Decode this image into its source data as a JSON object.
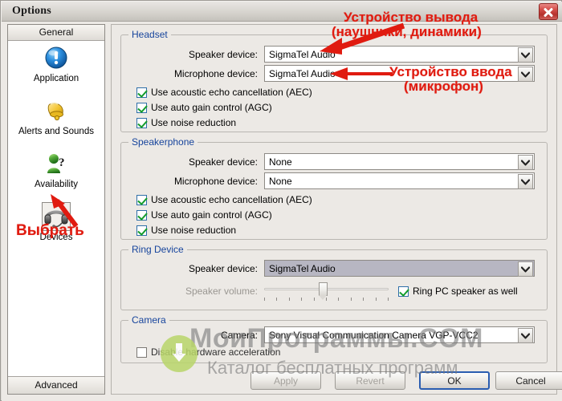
{
  "window": {
    "title": "Options",
    "close_tooltip": "Close"
  },
  "sidebar": {
    "header": "General",
    "footer": "Advanced",
    "items": [
      {
        "label": "Application",
        "icon": "exclamation-circle-icon"
      },
      {
        "label": "Alerts and Sounds",
        "icon": "bell-icon"
      },
      {
        "label": "Availability",
        "icon": "availability-question-icon"
      },
      {
        "label": "Devices",
        "icon": "headset-icon"
      }
    ]
  },
  "groups": {
    "headset": {
      "legend": "Headset",
      "speaker_label": "Speaker device:",
      "speaker_value": "SigmaTel Audio",
      "microphone_label": "Microphone device:",
      "microphone_value": "SigmaTel Audio",
      "checkboxes": [
        {
          "label": "Use acoustic echo cancellation (AEC)",
          "checked": true
        },
        {
          "label": "Use auto gain control (AGC)",
          "checked": true
        },
        {
          "label": "Use noise reduction",
          "checked": true
        }
      ]
    },
    "speakerphone": {
      "legend": "Speakerphone",
      "speaker_label": "Speaker device:",
      "speaker_value": "None",
      "microphone_label": "Microphone device:",
      "microphone_value": "None",
      "checkboxes": [
        {
          "label": "Use acoustic echo cancellation (AEC)",
          "checked": true
        },
        {
          "label": "Use auto gain control (AGC)",
          "checked": true
        },
        {
          "label": "Use noise reduction",
          "checked": true
        }
      ]
    },
    "ring_device": {
      "legend": "Ring Device",
      "speaker_label": "Speaker device:",
      "speaker_value": "SigmaTel Audio",
      "volume_label": "Speaker volume:",
      "volume_percent": 47,
      "ring_pc_speaker_label": "Ring PC speaker as well",
      "ring_pc_speaker_checked": true
    },
    "camera": {
      "legend": "Camera",
      "camera_label": "Camera:",
      "camera_value": "Sony Visual Communication Camera VGP-VCC2",
      "option_label": "Disable hardware acceleration",
      "option_checked": false
    }
  },
  "buttons": {
    "apply": {
      "label": "Apply",
      "enabled": false
    },
    "revert": {
      "label": "Revert",
      "enabled": false
    },
    "ok": {
      "label": "OK",
      "enabled": true
    },
    "cancel": {
      "label": "Cancel",
      "enabled": true
    }
  },
  "annotations": {
    "output_device_line1": "Устройство вывода",
    "output_device_line2": "(наушники, динамики)",
    "input_device_line1": "Устройство ввода",
    "input_device_line2": "(микрофон)",
    "select": "Выбрать"
  },
  "watermark": {
    "line1": "МоиПрограммы.COM",
    "line2": "Каталог бесплатных программ"
  },
  "colors": {
    "legend_blue": "#16449c",
    "annotation_red": "#e01b10",
    "title_bar": "#dcd9d4",
    "panel_bg": "#ece9e5",
    "check_green": "#139c2b",
    "watermark_green": "#b9d66a"
  }
}
